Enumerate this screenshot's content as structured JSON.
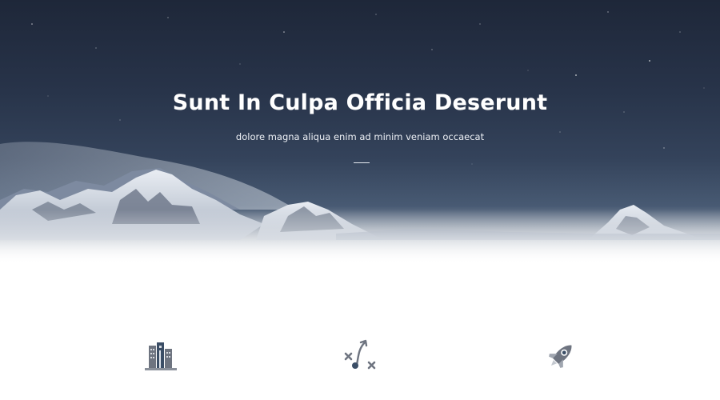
{
  "hero": {
    "title": "Sunt In Culpa Officia Deserunt",
    "subtitle": "dolore magna aliqua enim ad minim veniam occaecat"
  },
  "features": [
    {
      "icon": "buildings-icon"
    },
    {
      "icon": "strategy-icon"
    },
    {
      "icon": "rocket-icon"
    }
  ],
  "colors": {
    "hero_dark": "#1e2739",
    "hero_mid": "#34435b",
    "icon_gray": "#6e7480",
    "icon_accent": "#3b4e66"
  }
}
